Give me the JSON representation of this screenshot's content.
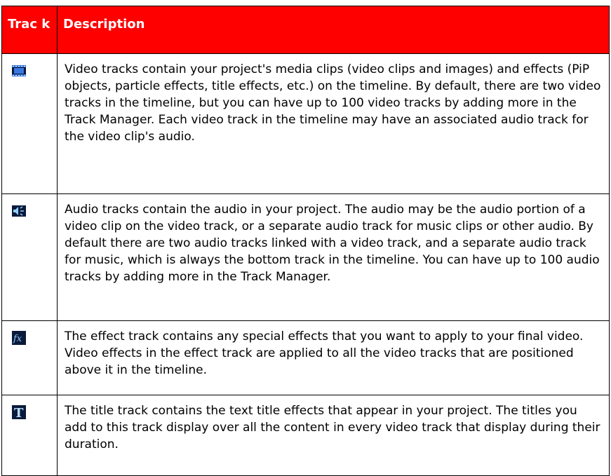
{
  "table": {
    "headers": {
      "track": "Trac k",
      "description": "Description"
    },
    "rows": [
      {
        "icon": "video-track-icon",
        "description": "Video tracks contain your project's media clips (video clips and images) and effects (PiP objects, particle effects, title effects, etc.) on the timeline. By default, there are two video tracks in the timeline, but you can have up to 100 video tracks by adding more in the Track Manager. Each video track in the timeline may have an associated audio track for the video clip's audio."
      },
      {
        "icon": "audio-track-icon",
        "description": "Audio tracks contain the audio in your project. The audio may be the audio portion of a video clip on the video track, or a separate audio track for music clips or other audio. By default there are two audio tracks linked with a video track, and a separate audio track for music, which is always the bottom track in the timeline. You can have up to 100 audio tracks by adding more in the Track Manager."
      },
      {
        "icon": "effect-track-icon",
        "description": "The effect track contains any special effects that you want to apply to your final video. Video effects in the effect track are applied to all the video tracks that are positioned above it in the timeline."
      },
      {
        "icon": "title-track-icon",
        "description": "The title track contains the text title effects that appear in your project. The titles you add to this track display over all the content in every video track that display during their duration."
      }
    ]
  },
  "colors": {
    "header_bg": "#ff0000",
    "header_text": "#ffffff",
    "border": "#000000"
  }
}
